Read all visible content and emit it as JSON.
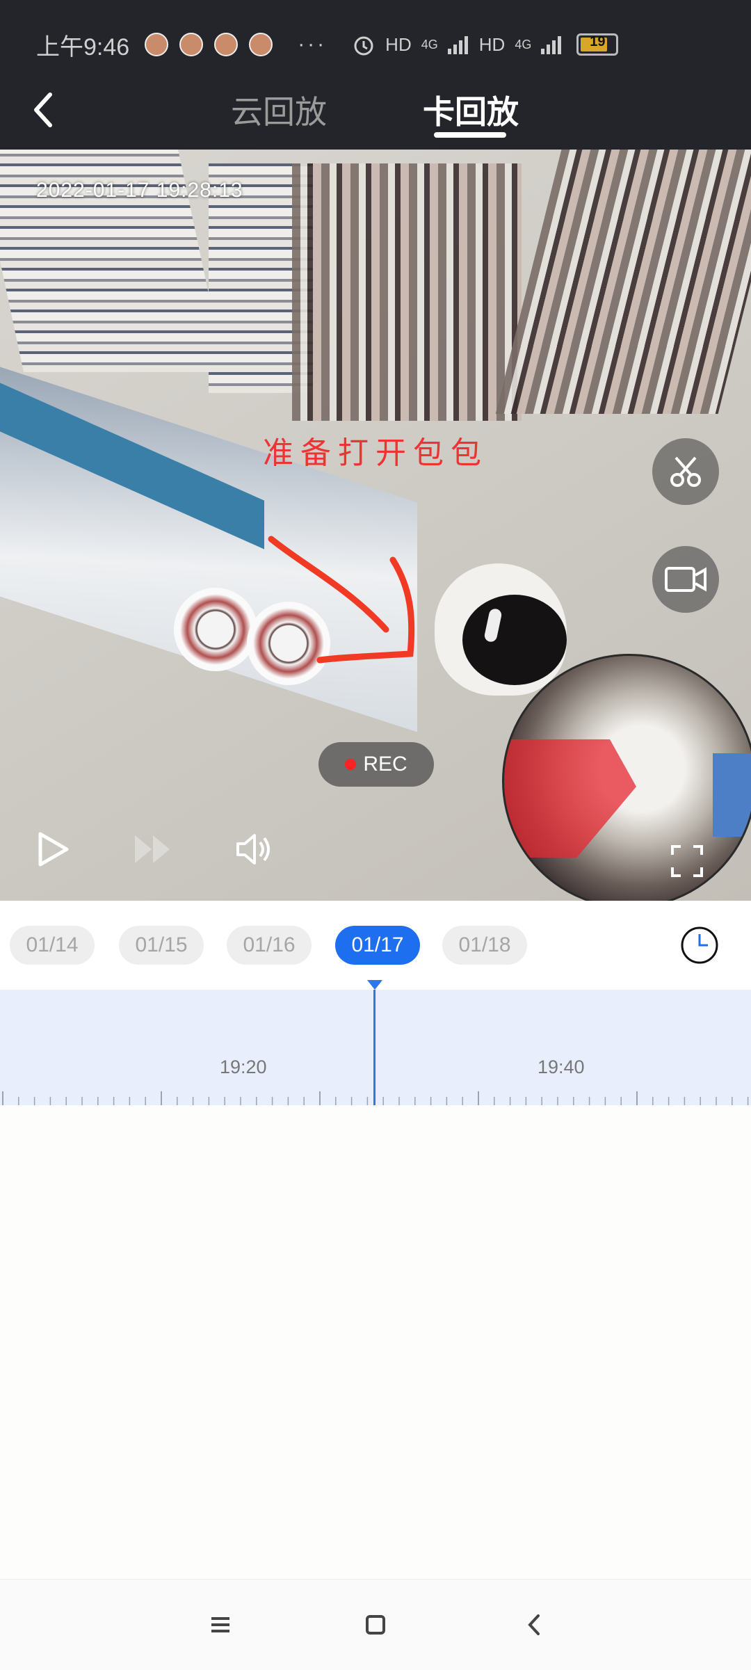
{
  "status_bar": {
    "time": "上午9:46",
    "dots": "···",
    "hd1": "HD",
    "net1": "4G",
    "hd2": "HD",
    "net2": "4G",
    "battery": "19"
  },
  "header": {
    "tabs": [
      {
        "label": "云回放",
        "active": false
      },
      {
        "label": "卡回放",
        "active": true
      }
    ]
  },
  "video": {
    "timestamp": "2022-01-17   19:28:13",
    "annotation": "准备打开包包",
    "rec_label": "REC"
  },
  "dates": [
    {
      "label": "01/14",
      "selected": false
    },
    {
      "label": "01/15",
      "selected": false
    },
    {
      "label": "01/16",
      "selected": false
    },
    {
      "label": "01/17",
      "selected": true
    },
    {
      "label": "01/18",
      "selected": false
    }
  ],
  "timeline": {
    "labels": [
      "19:20",
      "19:40"
    ]
  },
  "colors": {
    "accent": "#1e6ff0",
    "topbar": "#23252a",
    "annotation": "#e33333"
  }
}
